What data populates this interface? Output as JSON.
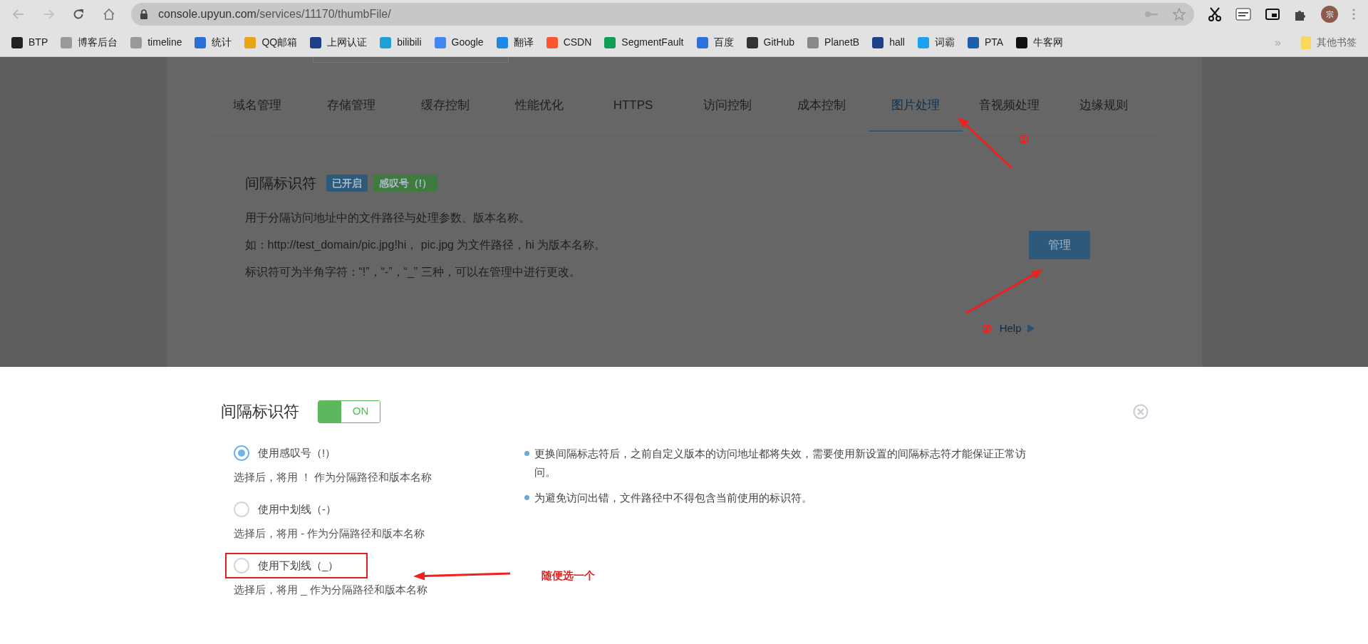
{
  "browser": {
    "url_host": "console.upyun.com",
    "url_path": "/services/11170/thumbFile/",
    "avatar": "宗",
    "bookmarks": [
      {
        "label": "BTP"
      },
      {
        "label": "博客后台"
      },
      {
        "label": "timeline"
      },
      {
        "label": "统计"
      },
      {
        "label": "QQ邮箱"
      },
      {
        "label": "上网认证"
      },
      {
        "label": "bilibili"
      },
      {
        "label": "Google"
      },
      {
        "label": "翻译"
      },
      {
        "label": "CSDN"
      },
      {
        "label": "SegmentFault"
      },
      {
        "label": "百度"
      },
      {
        "label": "GitHub"
      },
      {
        "label": "PlanetB"
      },
      {
        "label": "hall"
      },
      {
        "label": "词霸"
      },
      {
        "label": "PTA"
      },
      {
        "label": "牛客网"
      }
    ],
    "more": "»",
    "other_bookmarks": "其他书签"
  },
  "tabs": [
    {
      "label": "域名管理",
      "selected": false
    },
    {
      "label": "存储管理",
      "selected": false
    },
    {
      "label": "缓存控制",
      "selected": false
    },
    {
      "label": "性能优化",
      "selected": false
    },
    {
      "label": "HTTPS",
      "selected": false
    },
    {
      "label": "访问控制",
      "selected": false
    },
    {
      "label": "成本控制",
      "selected": false
    },
    {
      "label": "图片处理",
      "selected": true
    },
    {
      "label": "音视频处理",
      "selected": false
    },
    {
      "label": "边缘规则",
      "selected": false
    }
  ],
  "section": {
    "title": "间隔标识符",
    "badges": [
      {
        "label": "已开启",
        "color": "#2d5a7b"
      },
      {
        "label": "感叹号（!）",
        "color": "#3f7a3f"
      }
    ],
    "lines": [
      "用于分隔访问地址中的文件路径与处理参数、版本名称。",
      "如：http://test_domain/pic.jpg!hi， pic.jpg 为文件路径，hi 为版本名称。",
      "标识符可为半角字符：“!”，“-”，“_” 三种，可以在管理中进行更改。"
    ],
    "button": "管理",
    "help": "Help"
  },
  "dialog": {
    "title": "间隔标识符",
    "toggle": {
      "on": true,
      "label": "ON"
    },
    "options": [
      {
        "label": "使用感叹号（!）",
        "description": "选择后，将用 ！ 作为分隔路径和版本名称",
        "selected": true,
        "highlighted": false
      },
      {
        "label": "使用中划线（-）",
        "description": "选择后，将用 - 作为分隔路径和版本名称",
        "selected": false,
        "highlighted": false
      },
      {
        "label": "使用下划线（_）",
        "description": "选择后，将用 _ 作为分隔路径和版本名称",
        "selected": false,
        "highlighted": true
      }
    ],
    "notes": [
      "更换间隔标志符后，之前自定义版本的访问地址都将失效，需要使用新设置的间隔标志符才能保证正常访问。",
      "为避免访问出错，文件路径中不得包含当前使用的标识符。"
    ]
  },
  "annotations": [
    {
      "kind": "marker",
      "text": "①"
    },
    {
      "kind": "marker",
      "text": "②"
    },
    {
      "kind": "note",
      "text": "随便选一个"
    }
  ]
}
